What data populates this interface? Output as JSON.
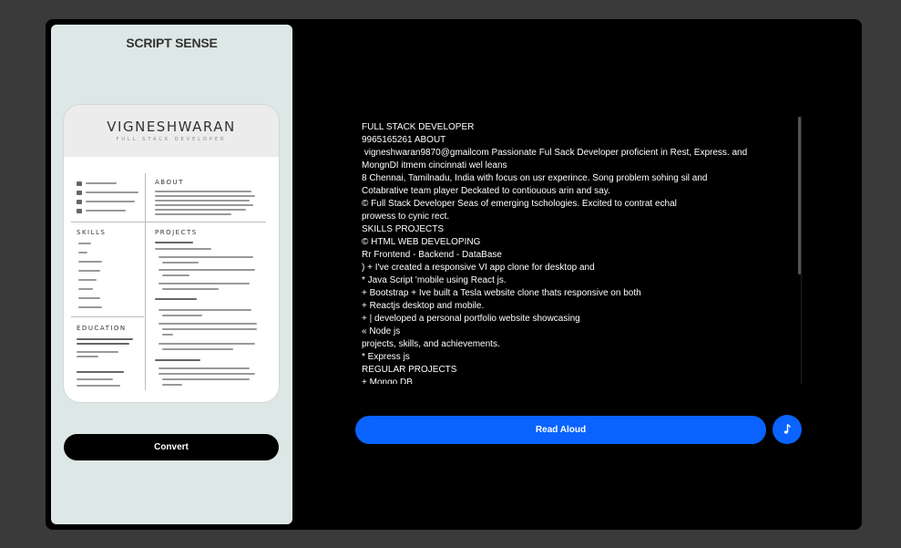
{
  "app": {
    "title": "SCRIPT SENSE"
  },
  "resume_preview": {
    "name": "VIGNESHWARAN",
    "role": "FULL STACK DEVELOPER",
    "sections": [
      "ABOUT",
      "SKILLS",
      "PROJECTS",
      "EDUCATION"
    ]
  },
  "actions": {
    "convert_label": "Convert",
    "read_aloud_label": "Read Aloud",
    "audio_icon": "music-note-icon"
  },
  "extracted_text": [
    "FULL STACK DEVELOPER",
    "9965165261 ABOUT",
    " vigneshwaran9870@gmailcom Passionate Ful Sack Developer proficient in Rest, Express. and",
    "MongnDI itmem cincinnati wel leans",
    "8 Chennai, Tamilnadu, India with focus on usr experince. Song problem sohing sil and",
    "Cotabrative team player Deckated to contiouous arin and say.",
    "© Full Stack Developer Seas of emerging tschologies. Excited to contrat echal",
    "prowess to cynic rect.",
    "SKILLS PROJECTS",
    "© HTML WEB DEVELOPING",
    "Rr Frontend - Backend - DataBase",
    ") + I've created a responsive VI app clone for desktop and",
    "* Java Script 'mobile using React js.",
    "+ Bootstrap + Ive built a Tesla website clone thats responsive on both",
    "+ Reactjs desktop and mobile.",
    "+ | developed a personal portfolio website showcasing",
    "« Node js",
    "projects, skills, and achievements.",
    "* Express js",
    "REGULAR PROJECTS",
    "+ Mongo DB"
  ],
  "colors": {
    "background": "#3a3a3a",
    "panel": "#000000",
    "preview_panel": "#dde7e6",
    "accent": "#0a63ff"
  }
}
